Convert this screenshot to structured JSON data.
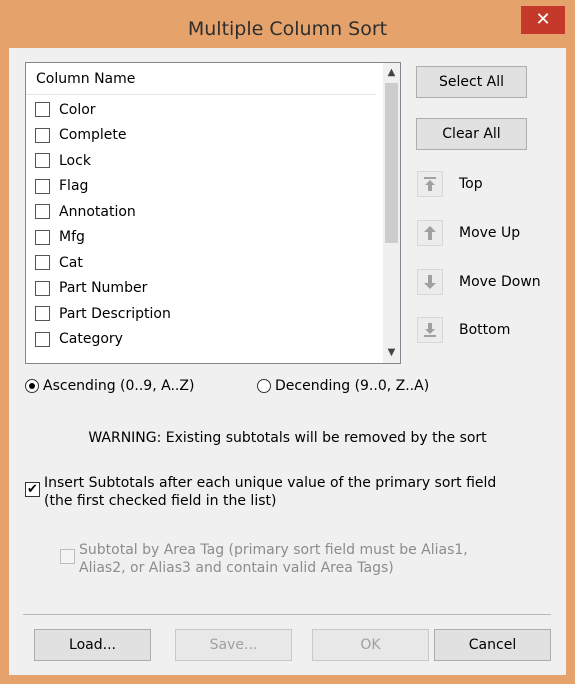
{
  "window": {
    "title": "Multiple Column Sort",
    "close_glyph": "✕",
    "title_bar_color": "#e5a36b",
    "close_button_color": "#c5392b"
  },
  "list": {
    "header": "Column Name",
    "items": [
      {
        "label": "Color",
        "checked": false
      },
      {
        "label": "Complete",
        "checked": false
      },
      {
        "label": "Lock",
        "checked": false
      },
      {
        "label": "Flag",
        "checked": false
      },
      {
        "label": "Annotation",
        "checked": false
      },
      {
        "label": "Mfg",
        "checked": false
      },
      {
        "label": "Cat",
        "checked": false
      },
      {
        "label": "Part Number",
        "checked": false
      },
      {
        "label": "Part Description",
        "checked": false
      },
      {
        "label": "Category",
        "checked": false
      }
    ]
  },
  "buttons": {
    "select_all": "Select All",
    "clear_all": "Clear All",
    "top": "Top",
    "move_up": "Move Up",
    "move_down": "Move Down",
    "bottom": "Bottom",
    "load": "Load...",
    "save": "Save...",
    "ok": "OK",
    "cancel": "Cancel"
  },
  "sort_order": {
    "ascending": "Ascending (0..9, A..Z)",
    "descending": "Decending (9..0, Z..A)",
    "selected": "ascending"
  },
  "warning": "WARNING: Existing subtotals will be removed by the sort",
  "options": {
    "insert_subtotals_line1": "Insert Subtotals after each unique value of the primary sort field",
    "insert_subtotals_line2": "(the first checked field in the list)",
    "insert_subtotals_checked": true,
    "subtotal_area_tag_line1": "Subtotal by Area Tag (primary sort field must be Alias1,",
    "subtotal_area_tag_line2": "Alias2, or Alias3 and contain valid Area Tags)",
    "subtotal_area_tag_checked": false,
    "subtotal_area_tag_enabled": false
  },
  "icons": {
    "top": "move-to-top-icon",
    "move_up": "arrow-up-icon",
    "move_down": "arrow-down-icon",
    "bottom": "move-to-bottom-icon"
  }
}
